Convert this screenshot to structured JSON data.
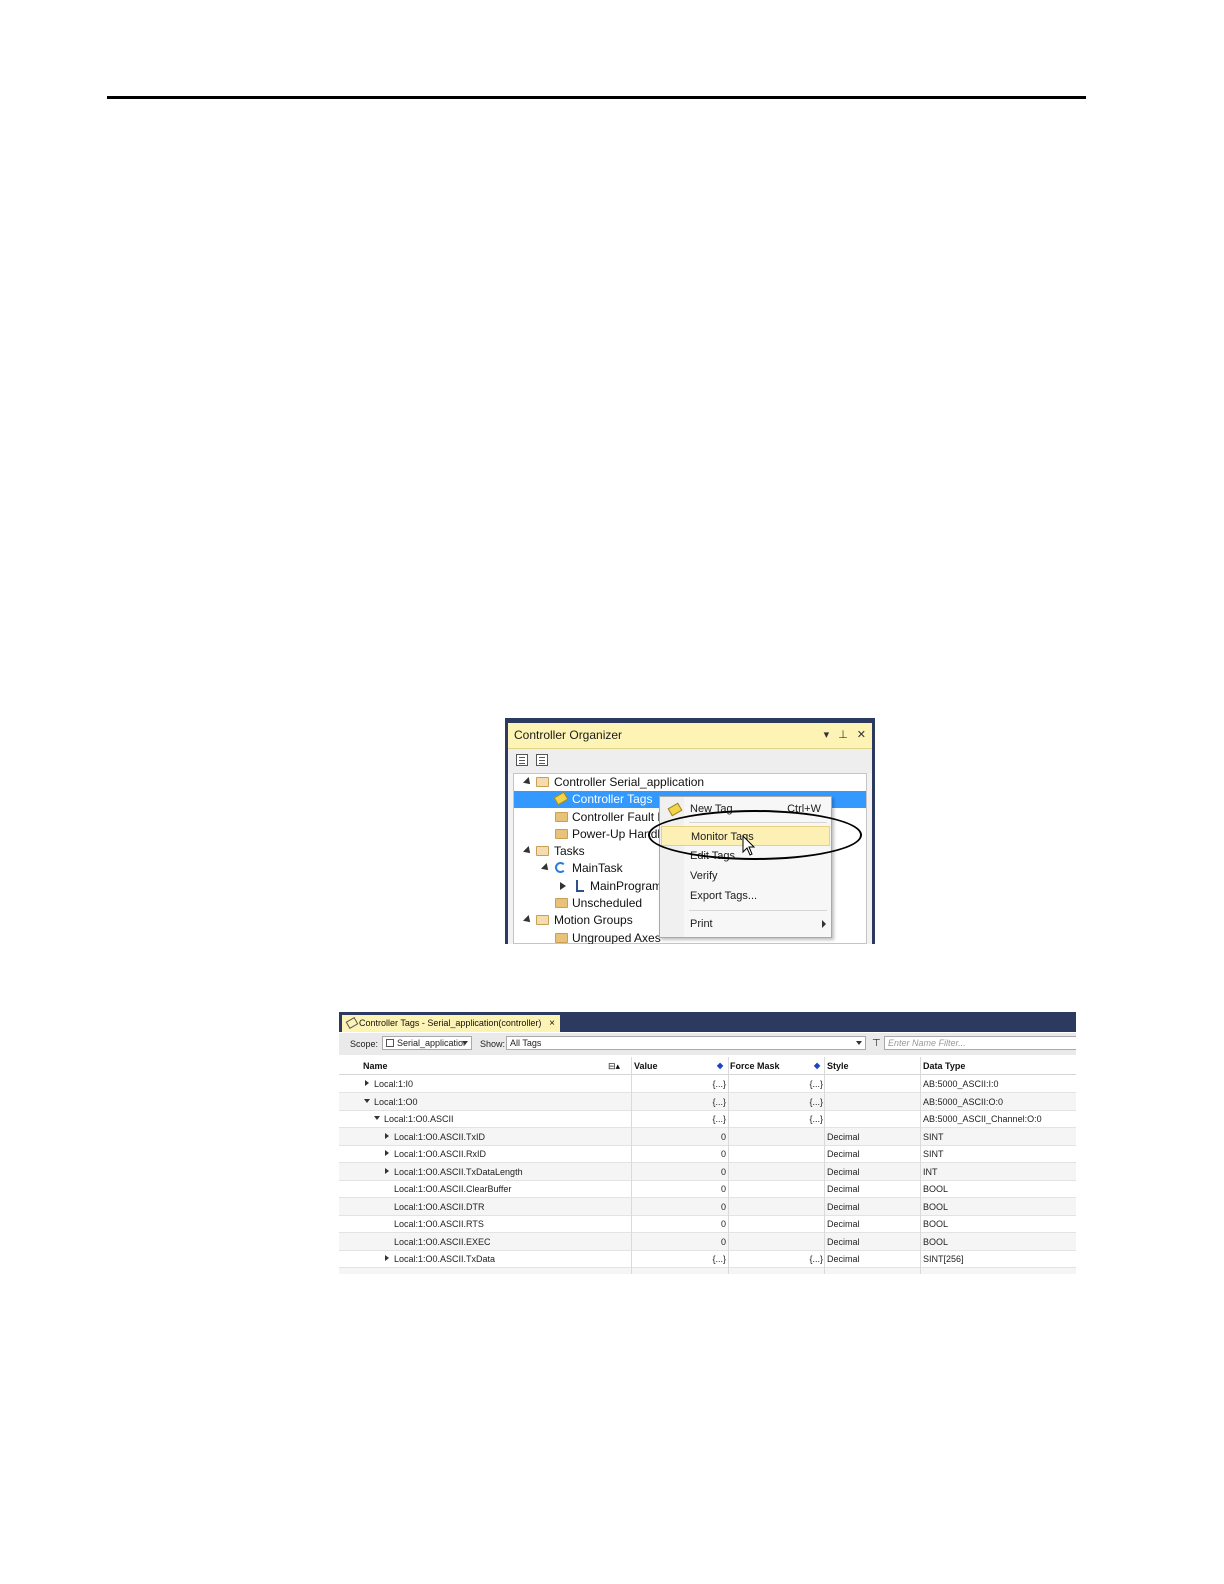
{
  "organizer": {
    "title": "Controller Organizer",
    "tree": [
      {
        "label": "Controller Serial_application"
      },
      {
        "label": "Controller Tags"
      },
      {
        "label": "Controller Fault H"
      },
      {
        "label": "Power-Up Handle"
      },
      {
        "label": "Tasks"
      },
      {
        "label": "MainTask"
      },
      {
        "label": "MainProgram"
      },
      {
        "label": "Unscheduled"
      },
      {
        "label": "Motion Groups"
      },
      {
        "label": "Ungrouped Axes"
      }
    ]
  },
  "context_menu": {
    "items": [
      {
        "label": "New Tag...",
        "shortcut": "Ctrl+W"
      },
      {
        "label": "Monitor Tags"
      },
      {
        "label": "Edit Tags"
      },
      {
        "label": "Verify"
      },
      {
        "label": "Export Tags..."
      },
      {
        "label": "Print"
      }
    ]
  },
  "tags_window": {
    "tab_title": "Controller Tags - Serial_application(controller)",
    "tab_close": "×",
    "scope_label": "Scope:",
    "scope_value": "Serial_applicatior",
    "show_label": "Show:",
    "show_value": "All Tags",
    "filter_placeholder": "Enter Name Filter...",
    "columns": {
      "name": "Name",
      "value": "Value",
      "force_mask": "Force Mask",
      "style": "Style",
      "data_type": "Data Type"
    },
    "rows": [
      {
        "name": "Local:1:I0",
        "value": "{...}",
        "force": "{...}",
        "style": "",
        "type": "AB:5000_ASCII:I:0"
      },
      {
        "name": "Local:1:O0",
        "value": "{...}",
        "force": "{...}",
        "style": "",
        "type": "AB:5000_ASCII:O:0"
      },
      {
        "name": "Local:1:O0.ASCII",
        "value": "{...}",
        "force": "{...}",
        "style": "",
        "type": "AB:5000_ASCII_Channel:O:0"
      },
      {
        "name": "Local:1:O0.ASCII.TxID",
        "value": "0",
        "force": "",
        "style": "Decimal",
        "type": "SINT"
      },
      {
        "name": "Local:1:O0.ASCII.RxID",
        "value": "0",
        "force": "",
        "style": "Decimal",
        "type": "SINT"
      },
      {
        "name": "Local:1:O0.ASCII.TxDataLength",
        "value": "0",
        "force": "",
        "style": "Decimal",
        "type": "INT"
      },
      {
        "name": "Local:1:O0.ASCII.ClearBuffer",
        "value": "0",
        "force": "",
        "style": "Decimal",
        "type": "BOOL"
      },
      {
        "name": "Local:1:O0.ASCII.DTR",
        "value": "0",
        "force": "",
        "style": "Decimal",
        "type": "BOOL"
      },
      {
        "name": "Local:1:O0.ASCII.RTS",
        "value": "0",
        "force": "",
        "style": "Decimal",
        "type": "BOOL"
      },
      {
        "name": "Local:1:O0.ASCII.EXEC",
        "value": "0",
        "force": "",
        "style": "Decimal",
        "type": "BOOL"
      },
      {
        "name": "Local:1:O0.ASCII.TxData",
        "value": "{...}",
        "force": "{...}",
        "style": "Decimal",
        "type": "SINT[256]"
      }
    ]
  },
  "colors": {
    "accent_selection": "#3399ff",
    "tab_active": "#fcf3b5",
    "frame": "#2b3a5e",
    "menu_highlight": "#fcf0b4"
  },
  "icons": [
    "tag-icon",
    "folder-icon",
    "task-icon",
    "program-icon",
    "pin-icon",
    "close-icon",
    "filter-icon",
    "cursor-icon"
  ]
}
